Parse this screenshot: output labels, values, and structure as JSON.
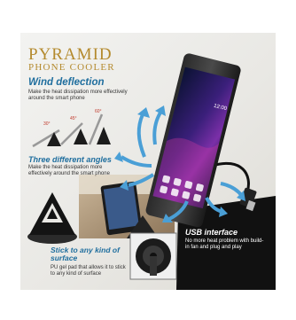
{
  "brand": {
    "line1": "PYRAMID",
    "line2": "PHONE COOLER"
  },
  "features": {
    "wind": {
      "title": "Wind deflection",
      "text": "Make the heat dissipation more effectively around the smart phone"
    },
    "angles": {
      "title": "Three different angles",
      "text": "Make the heat dissipation more effectively around the smart phone",
      "angle_labels": [
        "30°",
        "45°",
        "60°"
      ]
    },
    "stick": {
      "title": "Stick to any kind of surface",
      "text": "PU gel pad that allows it to stick to any kind of surface"
    },
    "usb": {
      "title": "USB interface",
      "text": "No more heat problem with build-in fan and plug and play"
    }
  },
  "colors": {
    "brand_gold": "#b48a2e",
    "headline_blue": "#1f6e9e",
    "arrow_blue": "#4a9fd6",
    "usb_panel": "#111111"
  }
}
